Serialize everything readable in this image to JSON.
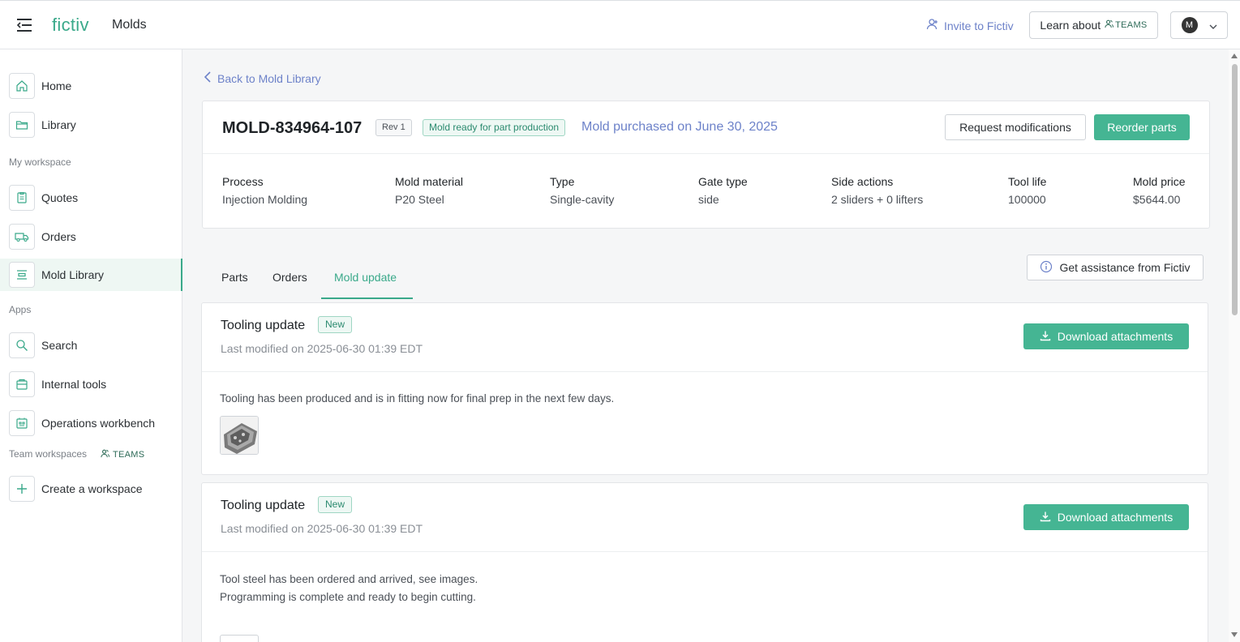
{
  "header": {
    "brand": "fictiv",
    "section": "Molds",
    "invite_label": "Invite to Fictiv",
    "learn_label": "Learn about",
    "teams_label": "TEAMS",
    "avatar_initial": "M"
  },
  "sidebar": {
    "items": [
      {
        "label": "Home",
        "icon": "home-icon"
      },
      {
        "label": "Library",
        "icon": "folder-icon"
      }
    ],
    "workspace_heading": "My workspace",
    "workspace_items": [
      {
        "label": "Quotes",
        "icon": "quotes-icon"
      },
      {
        "label": "Orders",
        "icon": "truck-icon"
      },
      {
        "label": "Mold Library",
        "icon": "mold-library-icon"
      }
    ],
    "apps_heading": "Apps",
    "app_items": [
      {
        "label": "Search",
        "icon": "search-icon"
      },
      {
        "label": "Internal tools",
        "icon": "tools-icon"
      },
      {
        "label": "Operations workbench",
        "icon": "workbench-icon"
      }
    ],
    "team_heading": "Team workspaces",
    "team_tag": "TEAMS",
    "create_workspace": "Create a workspace"
  },
  "main": {
    "back_label": "Back to Mold Library",
    "mold": {
      "id": "MOLD-834964-107",
      "rev": "Rev 1",
      "status": "Mold ready for part production",
      "purchased": "Mold purchased on June 30, 2025",
      "request_label": "Request modifications",
      "reorder_label": "Reorder parts",
      "specs": [
        {
          "key": "Process",
          "value": "Injection Molding"
        },
        {
          "key": "Mold material",
          "value": "P20 Steel"
        },
        {
          "key": "Type",
          "value": "Single-cavity"
        },
        {
          "key": "Gate type",
          "value": "side"
        },
        {
          "key": "Side actions",
          "value": "2 sliders + 0 lifters"
        },
        {
          "key": "Tool life",
          "value": "100000"
        },
        {
          "key": "Mold price",
          "value": "$5644.00"
        }
      ]
    },
    "tabs": [
      {
        "label": "Parts"
      },
      {
        "label": "Orders"
      },
      {
        "label": "Mold update"
      }
    ],
    "assist_label": "Get assistance from Fictiv",
    "updates": [
      {
        "title": "Tooling update",
        "badge": "New",
        "date": "Last modified on 2025-06-30 01:39 EDT",
        "download_label": "Download attachments",
        "body_lines": [
          "Tooling has been produced and is in fitting now for final prep in the next few days."
        ]
      },
      {
        "title": "Tooling update",
        "badge": "New",
        "date": "Last modified on 2025-06-30 01:39 EDT",
        "download_label": "Download attachments",
        "body_lines": [
          "Tool steel has been ordered and arrived, see images.",
          "Programming is complete and ready to begin cutting."
        ]
      }
    ]
  },
  "colors": {
    "accent": "#3aa98a",
    "button_green": "#45b593",
    "link_blue": "#6d82c9"
  }
}
